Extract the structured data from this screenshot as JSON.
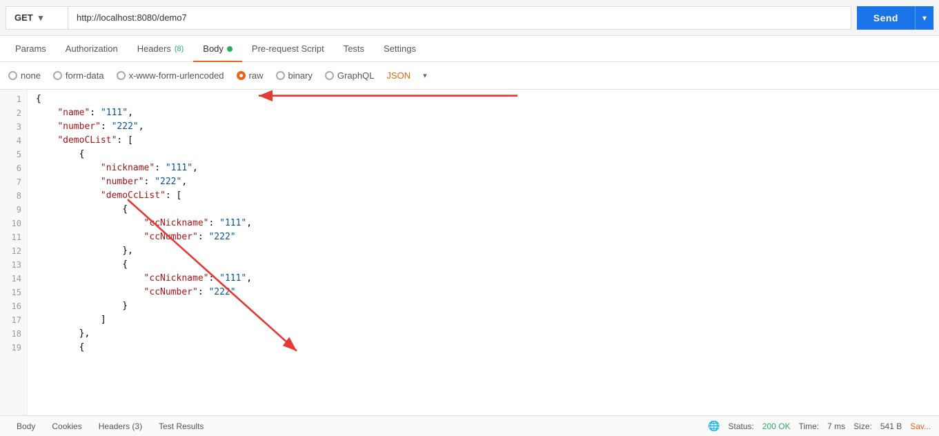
{
  "method": {
    "value": "GET",
    "label": "GET"
  },
  "url": {
    "value": "http://localhost:8080/demo7"
  },
  "send_button": {
    "label": "Send"
  },
  "tabs": [
    {
      "id": "params",
      "label": "Params",
      "active": false,
      "badge": null,
      "dot": null
    },
    {
      "id": "authorization",
      "label": "Authorization",
      "active": false,
      "badge": null,
      "dot": null
    },
    {
      "id": "headers",
      "label": "Headers",
      "active": false,
      "badge": "(8)",
      "dot": null
    },
    {
      "id": "body",
      "label": "Body",
      "active": true,
      "badge": null,
      "dot": "green"
    },
    {
      "id": "prerequest",
      "label": "Pre-request Script",
      "active": false,
      "badge": null,
      "dot": null
    },
    {
      "id": "tests",
      "label": "Tests",
      "active": false,
      "badge": null,
      "dot": null
    },
    {
      "id": "settings",
      "label": "Settings",
      "active": false,
      "badge": null,
      "dot": null
    }
  ],
  "body_options": [
    {
      "id": "none",
      "label": "none",
      "checked": false
    },
    {
      "id": "form-data",
      "label": "form-data",
      "checked": false
    },
    {
      "id": "urlencoded",
      "label": "x-www-form-urlencoded",
      "checked": false
    },
    {
      "id": "raw",
      "label": "raw",
      "checked": true
    },
    {
      "id": "binary",
      "label": "binary",
      "checked": false
    },
    {
      "id": "graphql",
      "label": "GraphQL",
      "checked": false
    }
  ],
  "format": {
    "label": "JSON",
    "dropdown": "▾"
  },
  "code_lines": [
    {
      "num": 1,
      "content": "{"
    },
    {
      "num": 2,
      "content": "    \"name\": \"111\","
    },
    {
      "num": 3,
      "content": "    \"number\": \"222\","
    },
    {
      "num": 4,
      "content": "    \"demoCList\": ["
    },
    {
      "num": 5,
      "content": "        {"
    },
    {
      "num": 6,
      "content": "            \"nickname\": \"111\","
    },
    {
      "num": 7,
      "content": "            \"number\": \"222\","
    },
    {
      "num": 8,
      "content": "            \"demoCcList\": ["
    },
    {
      "num": 9,
      "content": "                {"
    },
    {
      "num": 10,
      "content": "                    \"ccNickname\": \"111\","
    },
    {
      "num": 11,
      "content": "                    \"ccNumber\": \"222\""
    },
    {
      "num": 12,
      "content": "                },"
    },
    {
      "num": 13,
      "content": "                {"
    },
    {
      "num": 14,
      "content": "                    \"ccNickname\": \"111\","
    },
    {
      "num": 15,
      "content": "                    \"ccNumber\": \"222\""
    },
    {
      "num": 16,
      "content": "                }"
    },
    {
      "num": 17,
      "content": "            ]"
    },
    {
      "num": 18,
      "content": "        },"
    },
    {
      "num": 19,
      "content": "        {"
    }
  ],
  "status_bar": {
    "tabs": [
      "Body",
      "Cookies",
      "Headers (3)",
      "Test Results"
    ],
    "status_label": "Status:",
    "status_value": "200 OK",
    "time_label": "Time:",
    "time_value": "7 ms",
    "size_label": "Size:",
    "size_value": "541 B",
    "save_label": "Sav..."
  }
}
